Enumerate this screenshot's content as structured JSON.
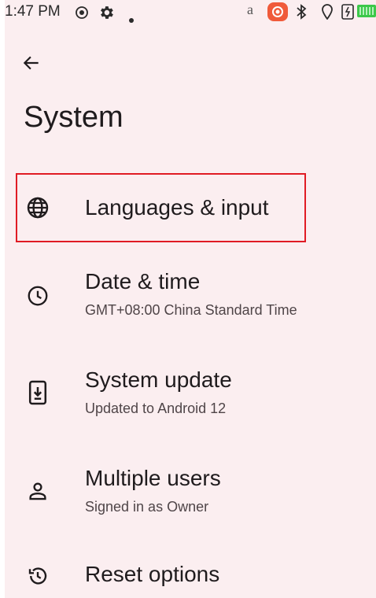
{
  "status_bar": {
    "time": "1:47 PM",
    "a_glyph": "a",
    "icons": [
      "radio-icon",
      "gear-icon",
      "dot-icon",
      "notification-icon",
      "bluetooth-icon",
      "location-icon",
      "sim-icon",
      "battery-icon"
    ]
  },
  "header": {
    "back_icon": "arrow-left-icon",
    "title": "System"
  },
  "items": [
    {
      "icon": "globe-icon",
      "title": "Languages & input",
      "summary": ""
    },
    {
      "icon": "clock-icon",
      "title": "Date & time",
      "summary": "GMT+08:00 China Standard Time"
    },
    {
      "icon": "system-update-icon",
      "title": "System update",
      "summary": "Updated to Android 12"
    },
    {
      "icon": "person-icon",
      "title": "Multiple users",
      "summary": "Signed in as Owner"
    },
    {
      "icon": "history-icon",
      "title": "Reset options",
      "summary": ""
    }
  ],
  "colors": {
    "background": "#fbeef0",
    "text": "#1f1b1d",
    "summary_text": "#4f4548",
    "highlight": "#e01b24",
    "notification_accent": "#f05a3a",
    "battery": "#3cc84a"
  }
}
